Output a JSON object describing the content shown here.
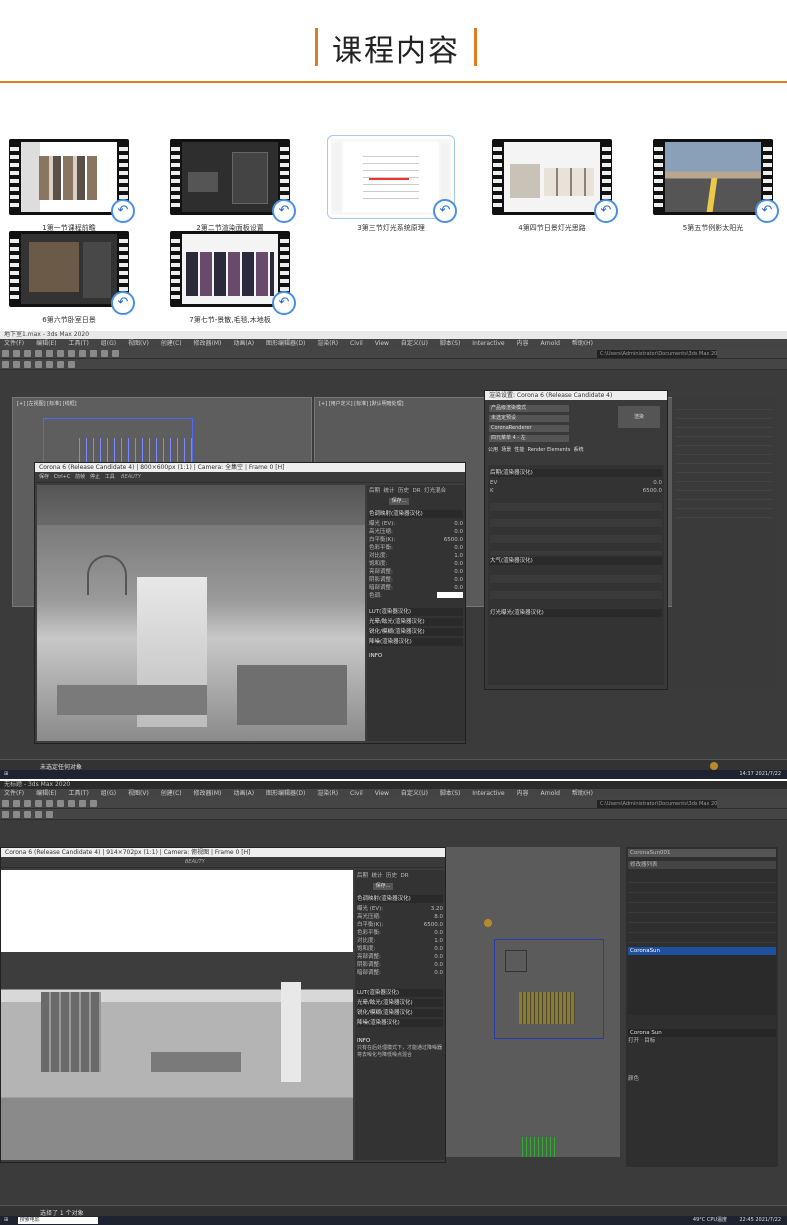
{
  "header": {
    "title": "课程内容"
  },
  "lessons": [
    {
      "caption": "1第一节课程前瞻"
    },
    {
      "caption": "2第二节渲染面板设置"
    },
    {
      "caption": "3第三节灯光系统原理"
    },
    {
      "caption": "4第四节日景灯光思路"
    },
    {
      "caption": "5第五节例影太阳光"
    },
    {
      "caption": "6第六节卧室日景"
    },
    {
      "caption": "7第七节-景散,毛毯,木地板"
    }
  ],
  "screen1": {
    "title": "地下室1.max - 3ds Max 2020",
    "menu": [
      "文件(F)",
      "编辑(E)",
      "工具(T)",
      "组(G)",
      "视图(V)",
      "创建(C)",
      "修改器(M)",
      "动画(A)",
      "图形编辑器(D)",
      "渲染(R)",
      "Civil View",
      "自定义(U)",
      "脚本(S)",
      "Interactive",
      "内容",
      "Arnold",
      "帮助(H)"
    ],
    "path": "C:\\Users\\Administrator\\Documents\\3ds Max 2020",
    "viewport_tl": "[+] [左视图] [标准] [线框]",
    "viewport_tr": "[+] [用户定义] [标准] [默认明暗处理]",
    "render_window": {
      "title": "Corona 6 (Release Candidate 4) | 800×600px (1:1) | Camera: 全集空 | Frame 0 [H]",
      "toolbar": [
        "保存",
        "Ctrl+C",
        "前帧",
        "停止",
        "工具"
      ],
      "beauty": "BEAUTY",
      "tabs": [
        "后期",
        "统计",
        "历史",
        "DR",
        "灯光混合"
      ],
      "save": "保存...",
      "section": "色调映射(渲染器汉化)",
      "rows": [
        {
          "label": "曝光 (EV):",
          "value": "0.0"
        },
        {
          "label": "高光压缩:",
          "value": "0.0"
        },
        {
          "label": "白平衡(K):",
          "value": "6500.0"
        },
        {
          "label": "色彩平衡:",
          "value": "0.0"
        },
        {
          "label": "对比度:",
          "value": "1.0"
        },
        {
          "label": "饱和度:",
          "value": "0.0"
        },
        {
          "label": "亮部调整:",
          "value": "0.0"
        },
        {
          "label": "阴影调整:",
          "value": "0.0"
        },
        {
          "label": "暗部调整:",
          "value": "0.0"
        }
      ],
      "color_label": "色调:",
      "panels": [
        "LUT(渲染器汉化)",
        "光晕/眩光(渲染器汉化)",
        "锐化/模糊(渲染器汉化)",
        "降噪(渲染器汉化)"
      ],
      "info": "INFO"
    },
    "render_setup": {
      "title": "渲染设置: Corona 6 (Release Candidate 4)",
      "target": "产品级渲染模式",
      "preset": "未选定预设",
      "renderer": "CoronaRenderer",
      "render_btn": "渲染",
      "view": "四元菜单 4 - 左",
      "tabs": [
        "公用",
        "场景",
        "性能",
        "Render Elements",
        "系统"
      ],
      "section1": "后期(渲染器汉化)",
      "exposure": "0.0",
      "kelvin": "6500.0",
      "section2": "大气(渲染器汉化)",
      "section3": "灯光曝光(渲染器汉化)"
    },
    "statusbar": "未选定任何对象",
    "clock": "14:37",
    "date": "2021/7/22"
  },
  "screen2": {
    "title": "无标题 - 3ds Max 2020",
    "render_window": {
      "title": "Corona 6 (Release Candidate 4) | 914×702px (1:1) | Camera: 俯视图 | Frame 0 [H]",
      "beauty": "BEAUTY",
      "tabs": [
        "后期",
        "统计",
        "历史",
        "DR",
        "灯光混合"
      ],
      "save": "保存...",
      "section": "色调映射(渲染器汉化)",
      "rows": [
        {
          "label": "曝光 (EV):",
          "value": "3.20"
        },
        {
          "label": "高光压缩:",
          "value": "8.0"
        },
        {
          "label": "白平衡(K):",
          "value": "6500.0"
        },
        {
          "label": "色彩平衡:",
          "value": "0.0"
        },
        {
          "label": "对比度:",
          "value": "1.0"
        },
        {
          "label": "饱和度:",
          "value": "0.0"
        },
        {
          "label": "亮部调整:",
          "value": "0.0"
        },
        {
          "label": "阴影调整:",
          "value": "0.0"
        },
        {
          "label": "暗部调整:",
          "value": "0.0"
        }
      ],
      "panels": [
        "LUT(渲染器汉化)",
        "光晕/眩光(渲染器汉化)",
        "锐化/模糊(渲染器汉化)",
        "降噪(渲染器汉化)"
      ],
      "info": "INFO",
      "info_text": "只有在后处理模式下，才能通过降噪器将去噪化与降低噪点混合"
    },
    "command_panel": {
      "object": "CoronaSun001",
      "list_label": "修改器列表",
      "selected": "CoronaSun",
      "rollout": "Corona Sun",
      "on": "打开",
      "target": "目标",
      "color_label": "颜色"
    },
    "search": "搜索电影",
    "statusbar": "选择了 1 个对象",
    "clock": "22:45",
    "date": "2021/7/22",
    "temp": "49°C CPU温度"
  }
}
